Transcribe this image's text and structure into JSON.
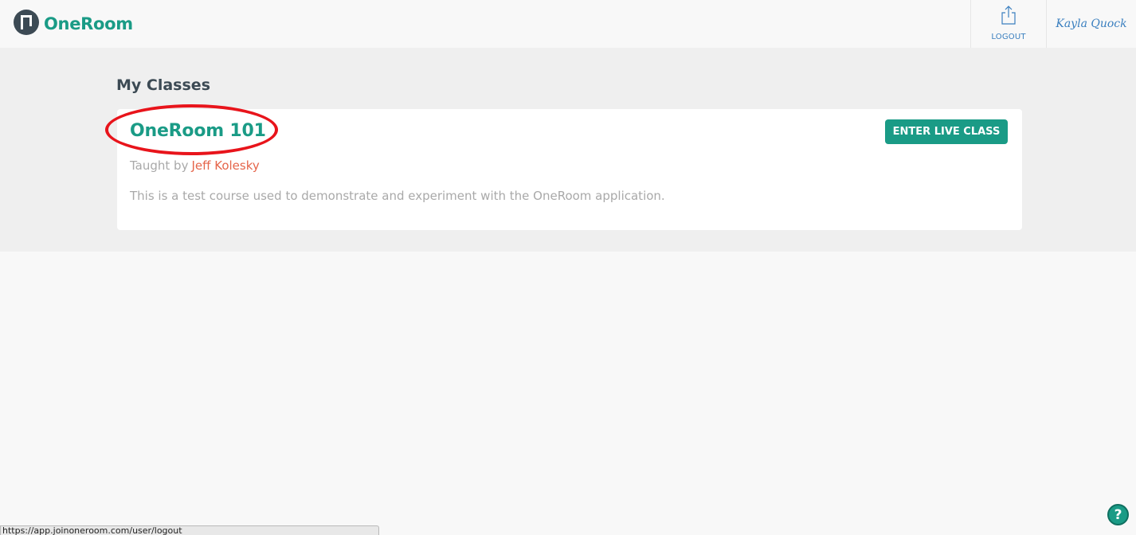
{
  "brand": {
    "name": "OneRoom",
    "logo_icon": "oneroom-logo-icon",
    "color": "#1a9b86"
  },
  "nav": {
    "logout_label": "LOGOUT",
    "logout_icon": "share-upload-icon",
    "user_name": "Kayla Quock"
  },
  "main": {
    "section_title": "My Classes",
    "classes": [
      {
        "title": "OneRoom 101",
        "taught_by_label": "Taught by",
        "teacher": "Jeff Kolesky",
        "description": "This is a test course used to demonstrate and experiment with the OneRoom application.",
        "action_label": "ENTER LIVE CLASS"
      }
    ]
  },
  "help": {
    "label": "?",
    "icon": "help-icon"
  },
  "status_bar": {
    "url": "https://app.joinoneroom.com/user/logout"
  },
  "colors": {
    "accent": "#1a9b86",
    "link_blue": "#3a7fbf",
    "teacher_link": "#e5654a",
    "annotation_ring": "#e8141b"
  }
}
